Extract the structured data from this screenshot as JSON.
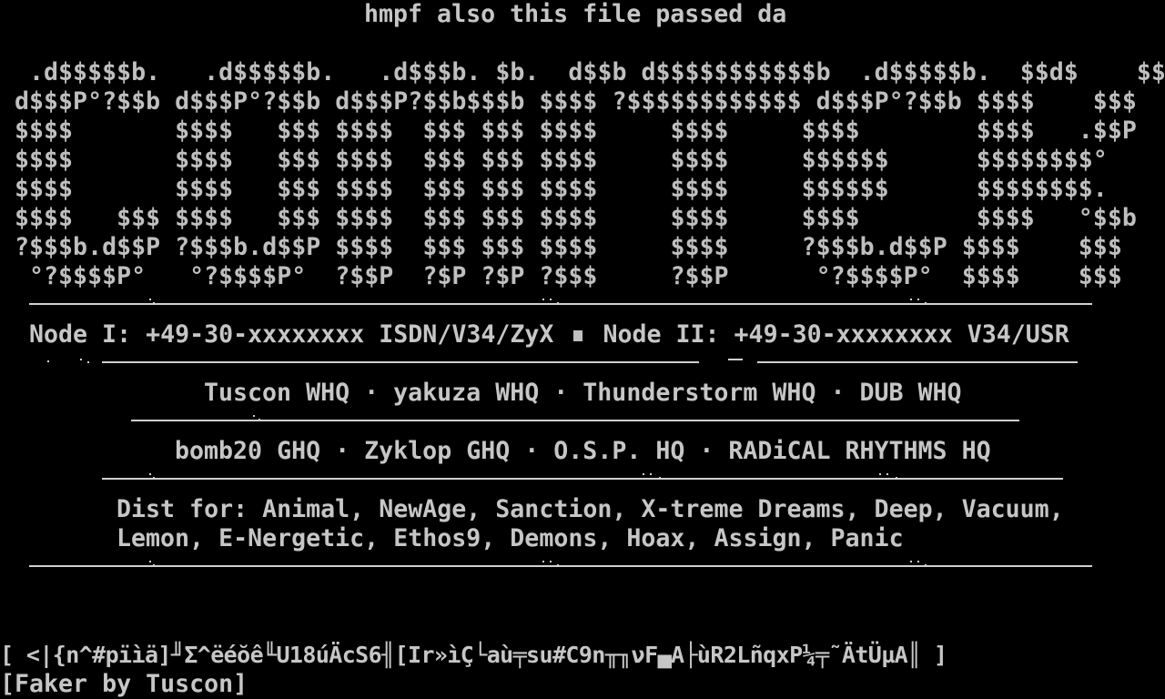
{
  "header": {
    "text": "hmpf also this file passed da"
  },
  "logo": {
    "lines": [
      "  .d$$$$$b.   .d$$$$$b.   .d$$$b. $b.  d$$b d$$$$$$$$$$$b  .d$$$$$b.  $$d$    $$$",
      " d$$$P°?$$b d$$$P°?$$b d$$$P?$$b$$$b $$$$ ?$$$$$$$$$$$$ d$$$P°?$$b $$$$    $$$",
      " $$$$       $$$$   $$$ $$$$  $$$ $$$ $$$$     $$$$     $$$$        $$$$   .$$P",
      " $$$$       $$$$   $$$ $$$$  $$$ $$$ $$$$     $$$$     $$$$$$      $$$$$$$$°",
      " $$$$       $$$$   $$$ $$$$  $$$ $$$ $$$$     $$$$     $$$$$$      $$$$$$$$.",
      " $$$$   $$$ $$$$   $$$ $$$$  $$$ $$$ $$$$     $$$$     $$$$        $$$$   °$$b",
      " ?$$$b.d$$P ?$$$b.d$$P $$$$  $$$ $$$ $$$$     $$$$     ?$$$b.d$$P $$$$    $$$",
      "  °?$$$$P°   °?$$$$P°  ?$$P  ?$P ?$P ?$$$     ?$$P      °?$$$$P°  $$$$    $$$"
    ]
  },
  "nodes": {
    "node1_label": "Node I:",
    "node1_number": "+49-30-xxxxxxxx ISDN/V34/ZyX",
    "node2_label": "Node II:",
    "node2_number": "+49-30-xxxxxxxx V34/USR"
  },
  "whq": {
    "text": "Tuscon WHQ · yakuza WHQ · Thunderstorm WHQ · DUB WHQ"
  },
  "ghq": {
    "text": "bomb20 GHQ · Zyklop GHQ · O.S.P. HQ · RADiCAL RHYTHMS HQ"
  },
  "dist": {
    "line1": "Dist for: Animal, NewAge, Sanction, X-treme Dreams, Deep, Vacuum,",
    "line2": "Lemon, E-Nergetic, Ethos9, Demons, Hoax, Assign, Panic"
  },
  "footer": {
    "garbage": "[ <|{n^#pïìä]╜Σ^ëéŏê╙U18úÄcS6╢[Ir»ìÇ└aù╤su#C9n╥╖νF▄A├ùR2LñqxP¼╤˜ÄtÜµA║ ]",
    "credit": "[Faker by Tuscon]"
  },
  "colors": {
    "background": "#000000",
    "foreground": "#bfbfbf"
  }
}
